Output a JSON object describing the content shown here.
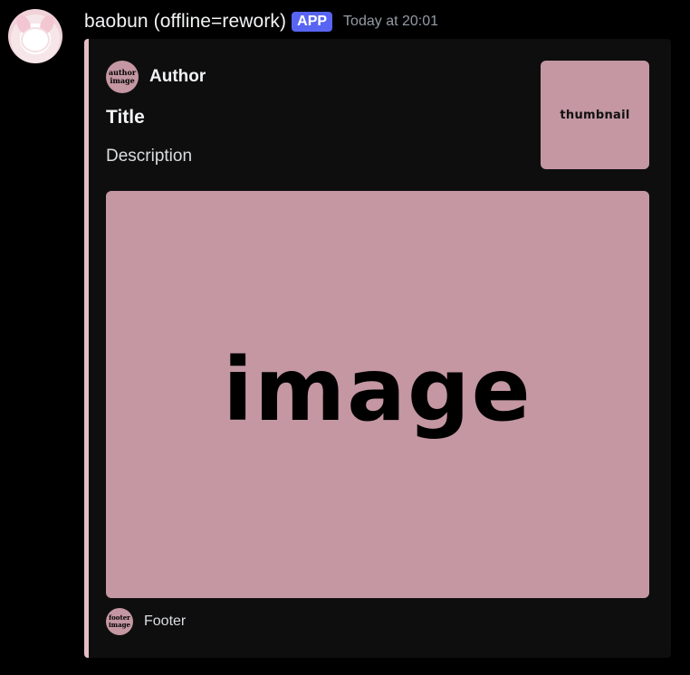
{
  "message": {
    "username": "baobun (offline=rework)",
    "badge": "APP",
    "timestamp": "Today at 20:01"
  },
  "embed": {
    "accent_color": "#e5bdc5",
    "author": {
      "icon_text": "author image",
      "name": "Author"
    },
    "title": "Title",
    "description": "Description",
    "thumbnail_text": "thumbnail",
    "image_text": "image",
    "footer": {
      "icon_text": "footer image",
      "text": "Footer"
    }
  },
  "colors": {
    "background": "#000000",
    "embed_bg": "#0e0e0f",
    "placeholder_pink": "#c497a2",
    "badge_blue": "#5865f2"
  }
}
